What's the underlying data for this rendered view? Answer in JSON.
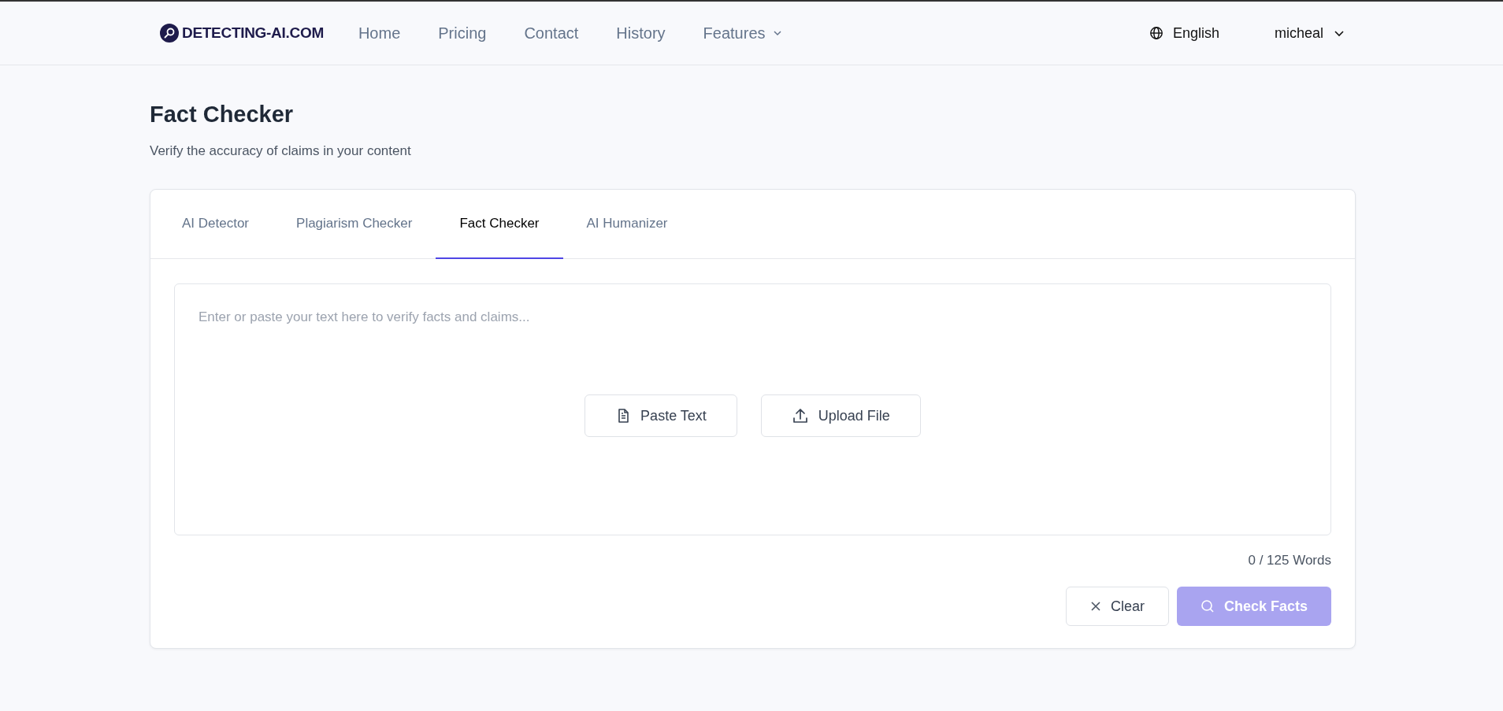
{
  "header": {
    "logo": "DETECTING-AI.COM",
    "nav": [
      {
        "label": "Home",
        "dropdown": false
      },
      {
        "label": "Pricing",
        "dropdown": false
      },
      {
        "label": "Contact",
        "dropdown": false
      },
      {
        "label": "History",
        "dropdown": false
      },
      {
        "label": "Features",
        "dropdown": true
      }
    ],
    "language": "English",
    "user": "micheal"
  },
  "page": {
    "title": "Fact Checker",
    "subtitle": "Verify the accuracy of claims in your content"
  },
  "tabs": [
    {
      "label": "AI Detector",
      "selected": false
    },
    {
      "label": "Plagiarism Checker",
      "selected": false
    },
    {
      "label": "Fact Checker",
      "selected": true
    },
    {
      "label": "AI Humanizer",
      "selected": false
    }
  ],
  "editor": {
    "placeholder": "Enter or paste your text here to verify facts and claims...",
    "buttons": [
      {
        "kind": "paste",
        "label": "Paste Text"
      },
      {
        "kind": "upload",
        "label": "Upload File"
      }
    ]
  },
  "word_count": "0 / 125 Words",
  "actions": [
    {
      "kind": "clear",
      "label": "Clear",
      "disabled": false
    },
    {
      "kind": "check",
      "label": "Check Facts",
      "disabled": true
    }
  ]
}
